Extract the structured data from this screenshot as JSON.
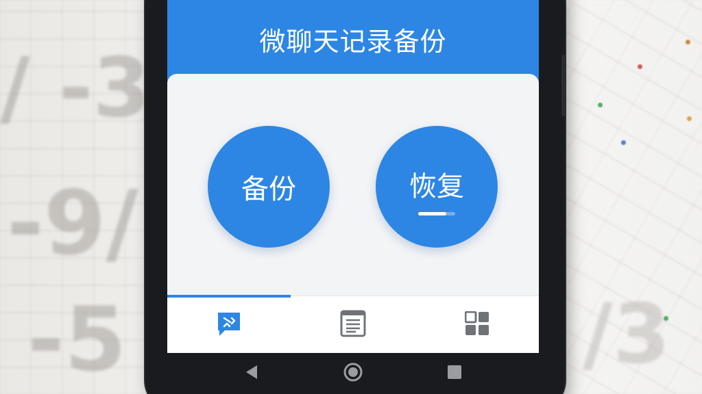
{
  "app": {
    "title": "微聊天记录备份"
  },
  "actions": {
    "backup_label": "备份",
    "restore_label": "恢复",
    "restore_progress": 0.75
  },
  "tabs": [
    {
      "id": "chat",
      "icon": "chat-sync-icon",
      "selected": true
    },
    {
      "id": "records",
      "icon": "document-list-icon",
      "selected": false
    },
    {
      "id": "apps",
      "icon": "grid-icon",
      "selected": false
    }
  ],
  "system_nav": [
    {
      "id": "back",
      "icon": "back-triangle-icon"
    },
    {
      "id": "home",
      "icon": "home-circle-icon"
    },
    {
      "id": "recents",
      "icon": "recents-square-icon"
    }
  ],
  "colors": {
    "accent": "#2d86e4",
    "card": "#f3f4f6",
    "tabbar": "#ffffff",
    "icon_gray": "#6f7378",
    "phone_body": "#1a1b1e"
  }
}
